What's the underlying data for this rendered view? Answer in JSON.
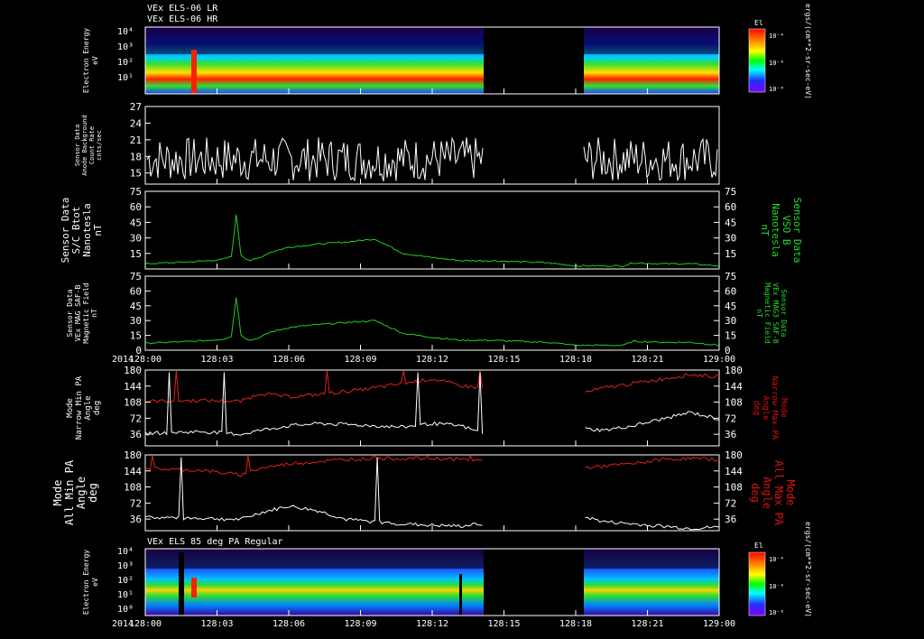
{
  "header": {
    "title_line1": "VEx ELS-06 LR",
    "title_line2": "VEx ELS-06 HR",
    "bottom_panel_title": "VEx ELS 85 deg PA Regular"
  },
  "colors": {
    "background": "#000000",
    "frame": "#ffffff",
    "mag_trace": "#1fcf1f",
    "max_pa_trace": "#e02020",
    "min_pa_trace": "#ffffff",
    "mag_label": "#22dd22",
    "max_pa_label": "#dd1111"
  },
  "time_axis": {
    "year_label": "2014",
    "tick_labels": [
      "128:00",
      "128:03",
      "128:06",
      "128:09",
      "128:12",
      "128:15",
      "128:18",
      "128:21",
      "129:00"
    ]
  },
  "colorbar": {
    "title": "El",
    "unit_label": "ergs/(cm**2-sr-sec-eV)",
    "tick_labels": [
      "10⁻⁴",
      "10⁻⁶",
      "10⁻⁸"
    ]
  },
  "chart_data": [
    {
      "type": "heatmap",
      "name": "els_lr_hr_spectrogram",
      "ylabel": [
        "Electron Energy",
        "eV"
      ],
      "y_tick_labels": [
        "10⁴",
        "10³",
        "10²",
        "10¹"
      ],
      "y_scale": "log",
      "data_gap": [
        "128:14",
        "128:18"
      ]
    },
    {
      "type": "line",
      "name": "anode_background",
      "ylabel": [
        "Sensor Data",
        "Anode Background",
        "Count Rate",
        "cnts/sec"
      ],
      "y_ticks": [
        15,
        18,
        21,
        24,
        27
      ],
      "ylim": [
        13,
        27
      ],
      "mean": 17.5,
      "spread": 2.5,
      "data_gap": [
        "128:14",
        "128:18"
      ]
    },
    {
      "type": "line",
      "name": "sc_bmag",
      "ylabel": [
        "Sensor Data",
        "S/C Btot",
        "Nanotesla",
        "nT"
      ],
      "ylabel_right": [
        "Sensor Data",
        "VSO B",
        "Nanotesla",
        "nT"
      ],
      "y_ticks": [
        15,
        30,
        45,
        60,
        75
      ],
      "y_ticks_right": [
        15,
        30,
        45,
        60,
        75
      ],
      "ylim": [
        0,
        75
      ],
      "x_minutes": [
        0,
        5,
        8,
        9,
        9.5,
        10,
        10.5,
        11,
        12,
        13,
        15,
        18,
        21,
        24,
        27,
        30,
        33,
        36,
        39,
        42,
        45,
        48,
        50,
        51,
        54,
        57,
        60
      ],
      "values": [
        5,
        7,
        9,
        12,
        52,
        14,
        10,
        8,
        11,
        16,
        21,
        24,
        26,
        29,
        15,
        11,
        8,
        8,
        7,
        6,
        3,
        3,
        3,
        6,
        5,
        5,
        3
      ]
    },
    {
      "type": "line",
      "name": "mag_saf_b",
      "ylabel": [
        "Sensor Data",
        "VEx MAG SAF-B",
        "Magnetic Field",
        "nT"
      ],
      "ylabel_right": [
        "Sensor Data",
        "VEx MAG3 SAF-B",
        "Magnetic Field",
        "nT"
      ],
      "y_ticks": [
        0,
        15,
        30,
        45,
        60,
        75
      ],
      "y_ticks_right": [
        0,
        15,
        30,
        45,
        60,
        75
      ],
      "ylim": [
        0,
        75
      ],
      "x_minutes": [
        0,
        5,
        8,
        9,
        9.5,
        10,
        10.5,
        11,
        12,
        13,
        15,
        18,
        21,
        24,
        27,
        30,
        33,
        36,
        39,
        42,
        45,
        48,
        50,
        51,
        54,
        57,
        60
      ],
      "values": [
        7,
        9,
        11,
        14,
        54,
        16,
        12,
        10,
        13,
        18,
        23,
        26,
        28,
        30,
        17,
        13,
        10,
        10,
        9,
        8,
        5,
        5,
        5,
        9,
        8,
        8,
        5
      ]
    },
    {
      "type": "line",
      "name": "narrow_pa",
      "ylabel": [
        "Mode",
        "Narrow Min PA",
        "Angle",
        "deg"
      ],
      "ylabel_right": [
        "Mode",
        "Narrow Max PA",
        "Angle",
        "deg"
      ],
      "y_ticks": [
        36,
        72,
        108,
        144,
        180
      ],
      "y_ticks_right": [
        36,
        72,
        108,
        144,
        180
      ],
      "ylim": [
        10,
        180
      ],
      "data_gap": [
        "128:14",
        "128:18"
      ],
      "series": [
        {
          "name": "Narrow Max PA",
          "x_minutes": [
            0,
            6,
            10,
            12,
            15,
            18,
            21,
            24,
            27,
            30,
            33,
            35,
            38,
            40,
            42,
            45,
            48,
            51,
            54,
            57,
            60
          ],
          "values": [
            110,
            112,
            110,
            128,
            120,
            125,
            132,
            140,
            150,
            160,
            145,
            140,
            150,
            150,
            115,
            125,
            140,
            150,
            160,
            170,
            165
          ]
        },
        {
          "name": "Narrow Min PA",
          "x_minutes": [
            0,
            6,
            10,
            12,
            15,
            18,
            21,
            24,
            27,
            30,
            33,
            35,
            38,
            40,
            42,
            45,
            48,
            51,
            54,
            57,
            60
          ],
          "values": [
            38,
            42,
            36,
            45,
            55,
            60,
            58,
            55,
            52,
            60,
            55,
            40,
            35,
            38,
            45,
            50,
            45,
            55,
            70,
            85,
            70
          ]
        }
      ]
    },
    {
      "type": "line",
      "name": "all_pa",
      "ylabel": [
        "Mode",
        "All Min PA",
        "Angle",
        "deg"
      ],
      "ylabel_right": [
        "Mode",
        "All Max PA",
        "Angle",
        "deg"
      ],
      "y_ticks": [
        36,
        72,
        108,
        144,
        180
      ],
      "y_ticks_right": [
        36,
        72,
        108,
        144,
        180
      ],
      "ylim": [
        10,
        180
      ],
      "data_gap": [
        "128:14",
        "128:18"
      ],
      "series": [
        {
          "name": "All Max PA",
          "x_minutes": [
            0,
            6,
            10,
            12,
            15,
            18,
            21,
            24,
            27,
            30,
            33,
            35,
            38,
            40,
            42,
            45,
            48,
            51,
            54,
            57,
            60
          ],
          "values": [
            150,
            145,
            135,
            150,
            160,
            165,
            170,
            172,
            172,
            172,
            170,
            168,
            165,
            140,
            145,
            150,
            155,
            160,
            170,
            172,
            170
          ]
        },
        {
          "name": "All Min PA",
          "x_minutes": [
            0,
            6,
            10,
            12,
            15,
            18,
            21,
            24,
            27,
            30,
            33,
            35,
            38,
            40,
            42,
            45,
            48,
            51,
            54,
            57,
            60
          ],
          "values": [
            40,
            38,
            35,
            50,
            65,
            55,
            35,
            30,
            25,
            22,
            20,
            25,
            30,
            45,
            55,
            45,
            30,
            25,
            20,
            15,
            18
          ]
        }
      ]
    },
    {
      "type": "heatmap",
      "name": "els_85deg_pa_spectrogram",
      "ylabel": [
        "Electron Energy",
        "eV"
      ],
      "y_tick_labels": [
        "10⁴",
        "10³",
        "10²",
        "10¹",
        "10⁰"
      ],
      "y_scale": "log",
      "data_gap": [
        "128:14",
        "128:18"
      ]
    }
  ]
}
